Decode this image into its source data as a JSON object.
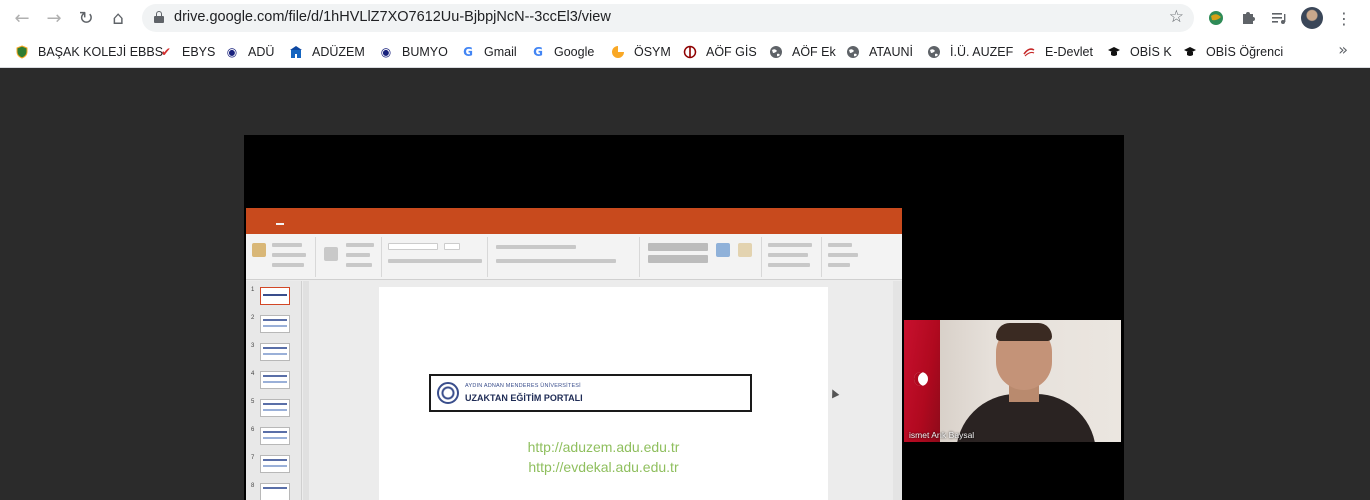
{
  "browser": {
    "url": "drive.google.com/file/d/1hHVLlZ7XO7612Uu-BjbpjNcN--3ccEl3/view",
    "nav_icons": [
      "back-arrow-icon",
      "forward-arrow-icon",
      "reload-icon",
      "home-icon"
    ],
    "toolbar_icons": [
      "bookmark-star-icon",
      "extension-globe-icon",
      "puzzle-icon",
      "media-queue-icon",
      "profile-avatar",
      "kebab-menu-icon"
    ]
  },
  "bookmarks": [
    {
      "label": "BAŞAK KOLEJİ EBBS",
      "icon": "shield-icon",
      "color": "#2e7d32"
    },
    {
      "label": "EBYS",
      "icon": "check-icon",
      "color": "#d32f2f"
    },
    {
      "label": "ADÜ",
      "icon": "drop-icon",
      "color": "#1a237e"
    },
    {
      "label": "ADÜZEM",
      "icon": "building-icon",
      "color": "#1565c0"
    },
    {
      "label": "BUMYO",
      "icon": "drop-icon",
      "color": "#1a237e"
    },
    {
      "label": "Gmail",
      "icon": "google-icon",
      "color": "#4285f4"
    },
    {
      "label": "Google",
      "icon": "google-icon",
      "color": "#4285f4"
    },
    {
      "label": "ÖSYM",
      "icon": "sun-icon",
      "color": "#f9a825"
    },
    {
      "label": "AÖF GİS",
      "icon": "circle-bar-icon",
      "color": "#8e0000"
    },
    {
      "label": "AÖF Ek",
      "icon": "globe-icon",
      "color": "#5f6368"
    },
    {
      "label": "ATAUNİ",
      "icon": "globe-icon",
      "color": "#5f6368"
    },
    {
      "label": "İ.Ü. AUZEF",
      "icon": "globe-icon",
      "color": "#5f6368"
    },
    {
      "label": "E-Devlet",
      "icon": "edevlet-icon",
      "color": "#c62828"
    },
    {
      "label": "OBİS K",
      "icon": "grad-cap-icon",
      "color": "#111111"
    },
    {
      "label": "OBİS Öğrenci",
      "icon": "grad-cap-icon",
      "color": "#111111"
    }
  ],
  "slide": {
    "university": "AYDIN ADNAN MENDERES ÜNİVERSİTESİ",
    "portal": "UZAKTAN EĞİTİM PORTALI",
    "links": [
      "http://aduzem.adu.edu.tr",
      "http://evdekal.adu.edu.tr"
    ]
  },
  "ppt": {
    "thumb_numbers": [
      "1",
      "2",
      "3",
      "4",
      "5",
      "6",
      "7",
      "8"
    ]
  },
  "webcam": {
    "name": "ismet Arık Baysal"
  },
  "colors": {
    "viewer_bg": "#2b2b2b",
    "ppt_accent": "#c84a1d",
    "link_green": "#8fbf5e"
  }
}
